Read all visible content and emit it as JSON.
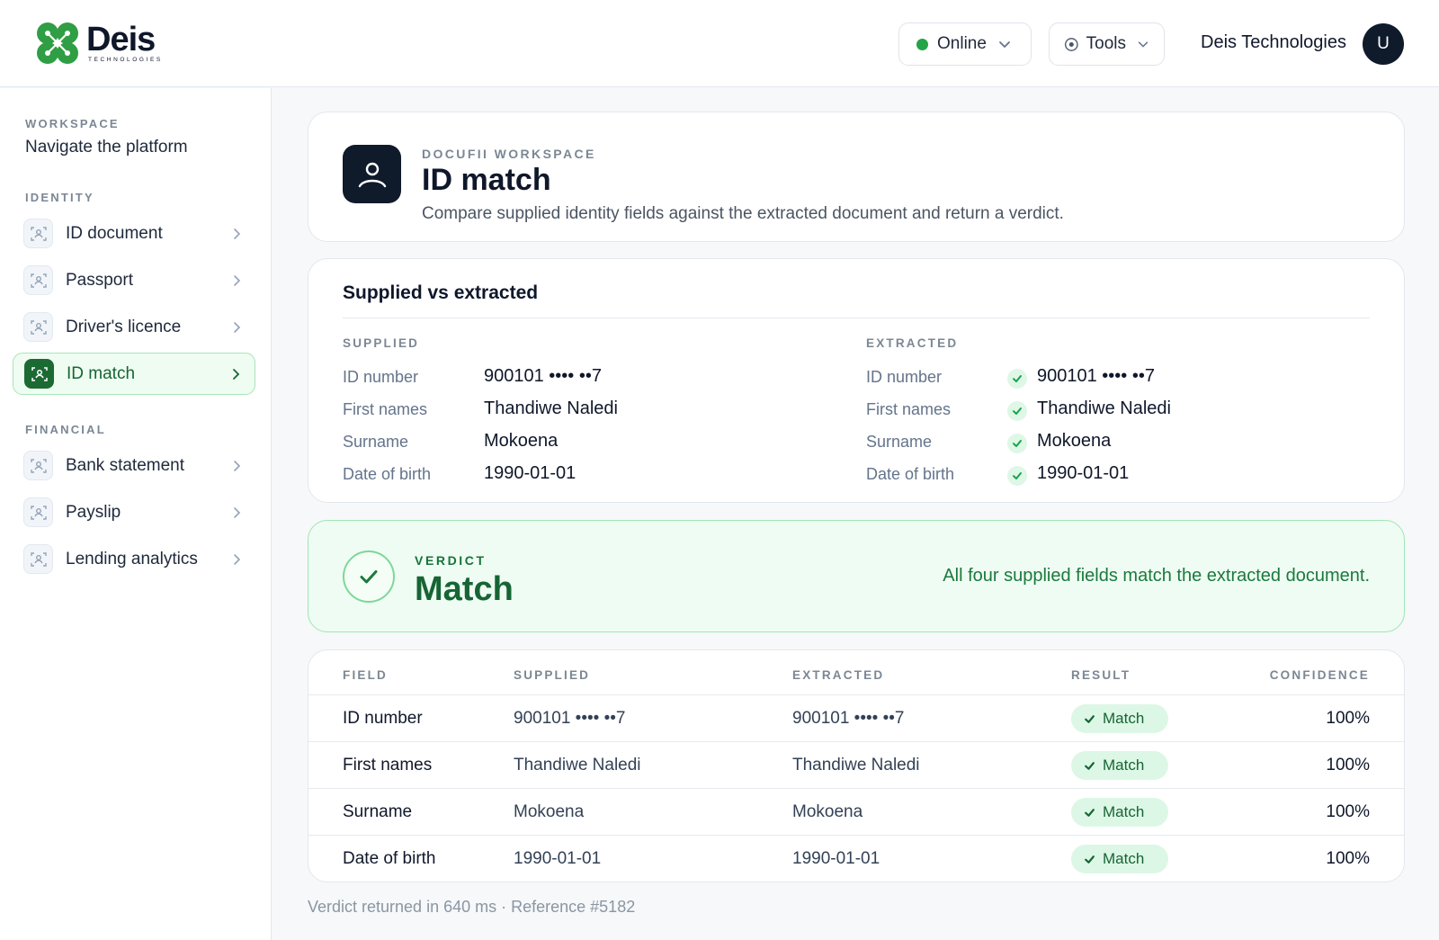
{
  "brand": {
    "name": "Deis",
    "sub": "TECHNOLOGIES",
    "colors": {
      "green": "#2f9e44",
      "dark": "#0f172a"
    }
  },
  "header": {
    "status_label": "Online",
    "tools_label": "Tools",
    "org_name": "Deis Technologies",
    "avatar_initial": "U"
  },
  "sidebar": {
    "kicker": "WORKSPACE",
    "subtitle": "Navigate the platform",
    "groups": [
      {
        "label": "IDENTITY",
        "items": [
          "ID document",
          "Passport",
          "Driver's licence",
          "ID match"
        ]
      },
      {
        "label": "FINANCIAL",
        "items": [
          "Bank statement",
          "Payslip",
          "Lending analytics"
        ]
      }
    ],
    "active_item": "ID match"
  },
  "page": {
    "kicker": "DOCUFII WORKSPACE",
    "title": "ID match",
    "description": "Compare supplied identity fields against the extracted document and return a verdict."
  },
  "compare": {
    "title": "Supplied vs extracted",
    "supplied_heading": "SUPPLIED",
    "extracted_heading": "EXTRACTED",
    "fields": [
      {
        "label": "ID number",
        "supplied": "900101 •••• ••7",
        "extracted": "900101 •••• ••7"
      },
      {
        "label": "First names",
        "supplied": "Thandiwe Naledi",
        "extracted": "Thandiwe Naledi"
      },
      {
        "label": "Surname",
        "supplied": "Mokoena",
        "extracted": "Mokoena"
      },
      {
        "label": "Date of birth",
        "supplied": "1990-01-01",
        "extracted": "1990-01-01"
      }
    ]
  },
  "verdict": {
    "kicker": "VERDICT",
    "value": "Match",
    "message": "All four supplied fields match the extracted document."
  },
  "table": {
    "headers": [
      "FIELD",
      "SUPPLIED",
      "EXTRACTED",
      "RESULT",
      "CONFIDENCE"
    ],
    "rows": [
      {
        "field": "ID number",
        "supplied": "900101 •••• ••7",
        "extracted": "900101 •••• ••7",
        "result": "Match",
        "confidence": "100%"
      },
      {
        "field": "First names",
        "supplied": "Thandiwe Naledi",
        "extracted": "Thandiwe Naledi",
        "result": "Match",
        "confidence": "100%"
      },
      {
        "field": "Surname",
        "supplied": "Mokoena",
        "extracted": "Mokoena",
        "result": "Match",
        "confidence": "100%"
      },
      {
        "field": "Date of birth",
        "supplied": "1990-01-01",
        "extracted": "1990-01-01",
        "result": "Match",
        "confidence": "100%"
      }
    ]
  },
  "footnote": "Verdict returned in 640 ms · Reference #5182"
}
